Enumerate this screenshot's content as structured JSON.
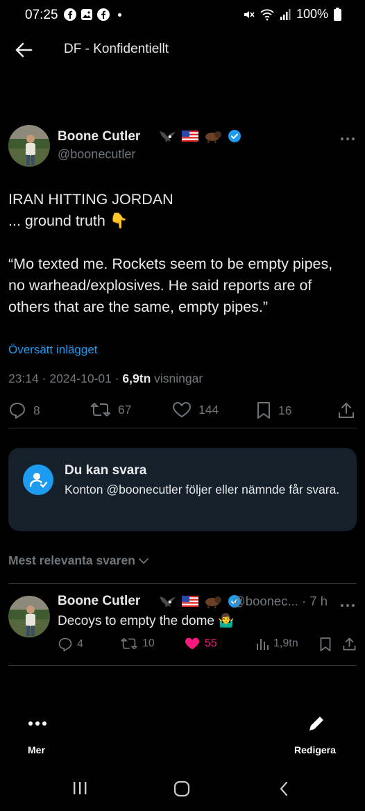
{
  "status_bar": {
    "time": "07:25",
    "battery": "100%",
    "icons": [
      "facebook-icon",
      "gallery-icon",
      "facebook-icon",
      "dot",
      "mute-icon",
      "wifi-icon",
      "signal-icon",
      "battery-icon"
    ]
  },
  "header": {
    "title": "DF - Konfidentiellt",
    "back_icon": "arrow-left-icon"
  },
  "post": {
    "author": {
      "name": "Boone Cutler",
      "handle": "@boonecutler",
      "emojis": [
        "eagle",
        "us-flag",
        "bison"
      ],
      "verified": true
    },
    "text_lines": [
      "IRAN HITTING JORDAN",
      "... ground truth 👇",
      "",
      "“Mo texted me. Rockets seem to be empty pipes,",
      "no warhead/explosives. He said reports are of",
      "others that are the same, empty pipes.”"
    ],
    "translate_label": "Översätt inlägget",
    "timestamp": "23:14 · 2024-10-01 · ",
    "views_count": "6,9tn",
    "views_label": " visningar",
    "actions": {
      "replies": "8",
      "reposts": "67",
      "likes": "144",
      "bookmarks": "16"
    }
  },
  "reply_restriction": {
    "title": "Du kan svara",
    "body": "Konton @boonecutler följer eller nämnde får svara."
  },
  "replies_sort": {
    "label": "Mest relevanta svaren"
  },
  "replies": [
    {
      "name": "Boone Cutler",
      "handle_time": "@boonec... · 7 h",
      "text": "Decoys to empty the dome 🤷‍♂️",
      "replies": "4",
      "reposts": "10",
      "likes": "55",
      "views": "1,9tn",
      "liked": true
    }
  ],
  "bottom_bar": {
    "more_label": "Mer",
    "edit_label": "Redigera"
  },
  "colors": {
    "background": "#000000",
    "text": "#e7e9ea",
    "secondary": "#71767b",
    "accent": "#1d9bf0",
    "like": "#f91880",
    "card": "#16202a"
  }
}
